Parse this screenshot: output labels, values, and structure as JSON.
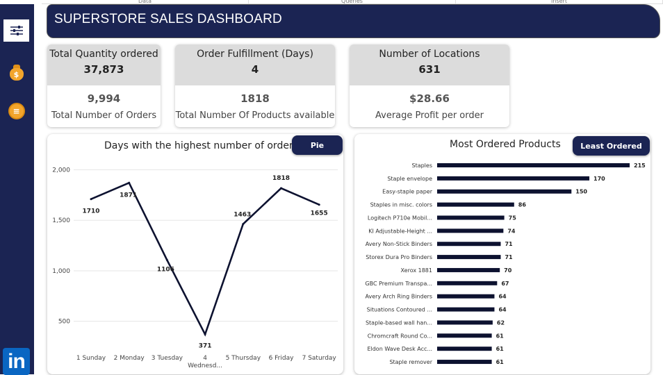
{
  "top_strip": [
    "Data",
    "Queries",
    "Insert"
  ],
  "header": {
    "title": "SUPERSTORE SALES DASHBOARD"
  },
  "sidebar": {
    "items": [
      {
        "icon": "sliders-icon"
      },
      {
        "icon": "money-bag-icon",
        "glyph": "$"
      },
      {
        "icon": "coin-icon",
        "glyph": "≡"
      }
    ],
    "linkedin": "in"
  },
  "kpis": [
    {
      "top_label": "Total Quantity ordered",
      "top_value": "37,873",
      "bottom_value": "9,994",
      "bottom_label": "Total Number of Orders"
    },
    {
      "top_label": "Order Fulfillment (Days)",
      "top_value": "4",
      "bottom_value": "1818",
      "bottom_label": "Total Number Of Products available"
    },
    {
      "top_label": "Number of Locations",
      "top_value": "631",
      "bottom_value": "$28.66",
      "bottom_label": "Average Profit per order"
    }
  ],
  "line_panel": {
    "title": "Days with the highest number of orders",
    "button": "Pie"
  },
  "bar_panel": {
    "title": "Most Ordered Products",
    "button": "Least Ordered"
  },
  "colors": {
    "navy": "#1b2453",
    "kpi_grey": "#dcdcdc",
    "accent_gold": "#f2a52c"
  },
  "chart_data": [
    {
      "type": "line",
      "categories": [
        "1 Sunday",
        "2 Monday",
        "3 Tuesday",
        "4 Wednesd...",
        "5 Thursday",
        "6 Friday",
        "7 Saturday"
      ],
      "values": [
        1710,
        1871,
        1106,
        371,
        1463,
        1818,
        1655
      ],
      "data_labels": [
        "1710",
        "1871",
        "1106",
        "371",
        "1463",
        "1818",
        "1655"
      ],
      "yticks": [
        "2,000",
        "1,500",
        "1,000",
        "500"
      ],
      "ytick_values": [
        2000,
        1500,
        1000,
        500
      ],
      "ylim": [
        250,
        2100
      ],
      "title": "Days with the highest number of orders",
      "grid": true
    },
    {
      "type": "bar",
      "orientation": "horizontal",
      "categories": [
        "Staples",
        "Staple envelope",
        "Easy-staple paper",
        "Staples in misc. colors",
        "Logitech P710e Mobil...",
        "KI Adjustable-Height ...",
        "Avery Non-Stick Binders",
        "Storex Dura Pro Binders",
        "Xerox 1881",
        "GBC Premium Transpa...",
        "Avery Arch Ring Binders",
        "Situations Contoured ...",
        "Staple-based wall han...",
        "Chromcraft Round Co...",
        "Eldon Wave Desk Acc...",
        "Staple remover"
      ],
      "values": [
        215,
        170,
        150,
        86,
        75,
        74,
        71,
        71,
        70,
        67,
        64,
        64,
        62,
        61,
        61,
        61
      ],
      "title": "Most Ordered Products",
      "xlim": [
        0,
        215
      ]
    }
  ]
}
